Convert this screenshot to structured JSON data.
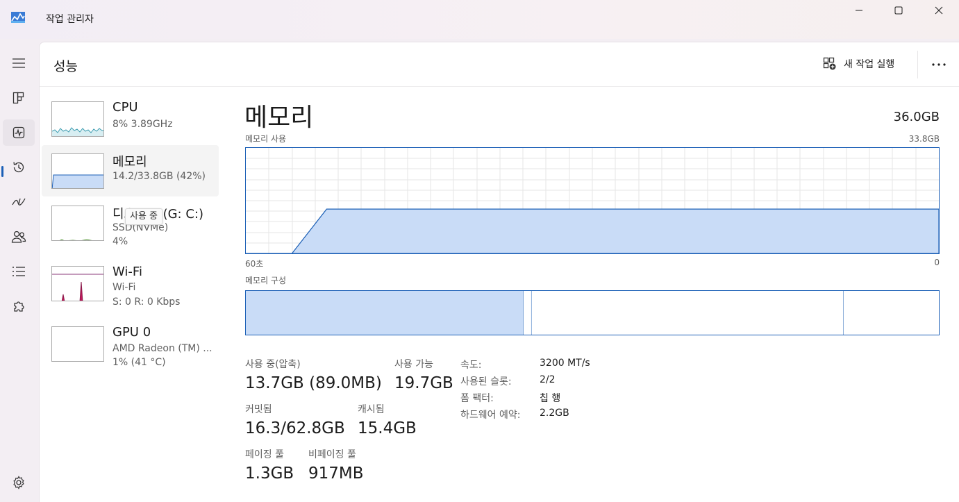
{
  "window": {
    "title": "작업 관리자"
  },
  "header": {
    "title": "성능",
    "run_task_label": "새 작업 실행"
  },
  "sidebar": {
    "items": [
      {
        "name": "CPU",
        "line1": "8%  3.89GHz",
        "line2": ""
      },
      {
        "name": "메모리",
        "line1": "14.2/33.8GB (42%)",
        "line2": ""
      },
      {
        "name": "디스크 0 (G: C:)",
        "line1": "SSD(NVMe)",
        "line2": "4%"
      },
      {
        "name": "Wi-Fi",
        "line1": "Wi-Fi",
        "line2": "S: 0  R: 0 Kbps"
      },
      {
        "name": "GPU 0",
        "line1": "AMD Radeon (TM) ...",
        "line2": "1%  (41 °C)"
      }
    ],
    "tooltip": "사용 중"
  },
  "memory": {
    "title": "메모리",
    "total": "36.0GB",
    "usage_label": "메모리 사용",
    "usage_max": "33.8GB",
    "axis_left": "60초",
    "axis_right": "0",
    "composition_label": "메모리 구성",
    "composition": {
      "in_use": 13.7,
      "modified": 0.4,
      "standby": 15.4,
      "free": 4.7
    },
    "stats": {
      "in_use_label": "사용 중(압축)",
      "in_use_value": "13.7GB (89.0MB)",
      "available_label": "사용 가능",
      "available_value": "19.7GB",
      "committed_label": "커밋됨",
      "committed_value": "16.3/62.8GB",
      "cached_label": "캐시됨",
      "cached_value": "15.4GB",
      "paged_label": "페이징 풀",
      "paged_value": "1.3GB",
      "nonpaged_label": "비페이징 풀",
      "nonpaged_value": "917MB"
    },
    "details": [
      {
        "key": "속도:",
        "value": "3200 MT/s"
      },
      {
        "key": "사용된 슬롯:",
        "value": "2/2"
      },
      {
        "key": "폼 팩터:",
        "value": "칩 행"
      },
      {
        "key": "하드웨어 예약:",
        "value": "2.2GB"
      }
    ]
  },
  "chart_data": {
    "type": "area",
    "title": "메모리 사용",
    "x": [
      60,
      56,
      53,
      0
    ],
    "values": [
      0,
      0,
      14.2,
      14.2
    ],
    "ylim": [
      0,
      33.8
    ],
    "xlabel": "",
    "ylabel": "",
    "grid": true
  },
  "colors": {
    "accent": "#1b5fb6",
    "fill": "#c9dcf7",
    "grid": "#e5e5e5"
  }
}
